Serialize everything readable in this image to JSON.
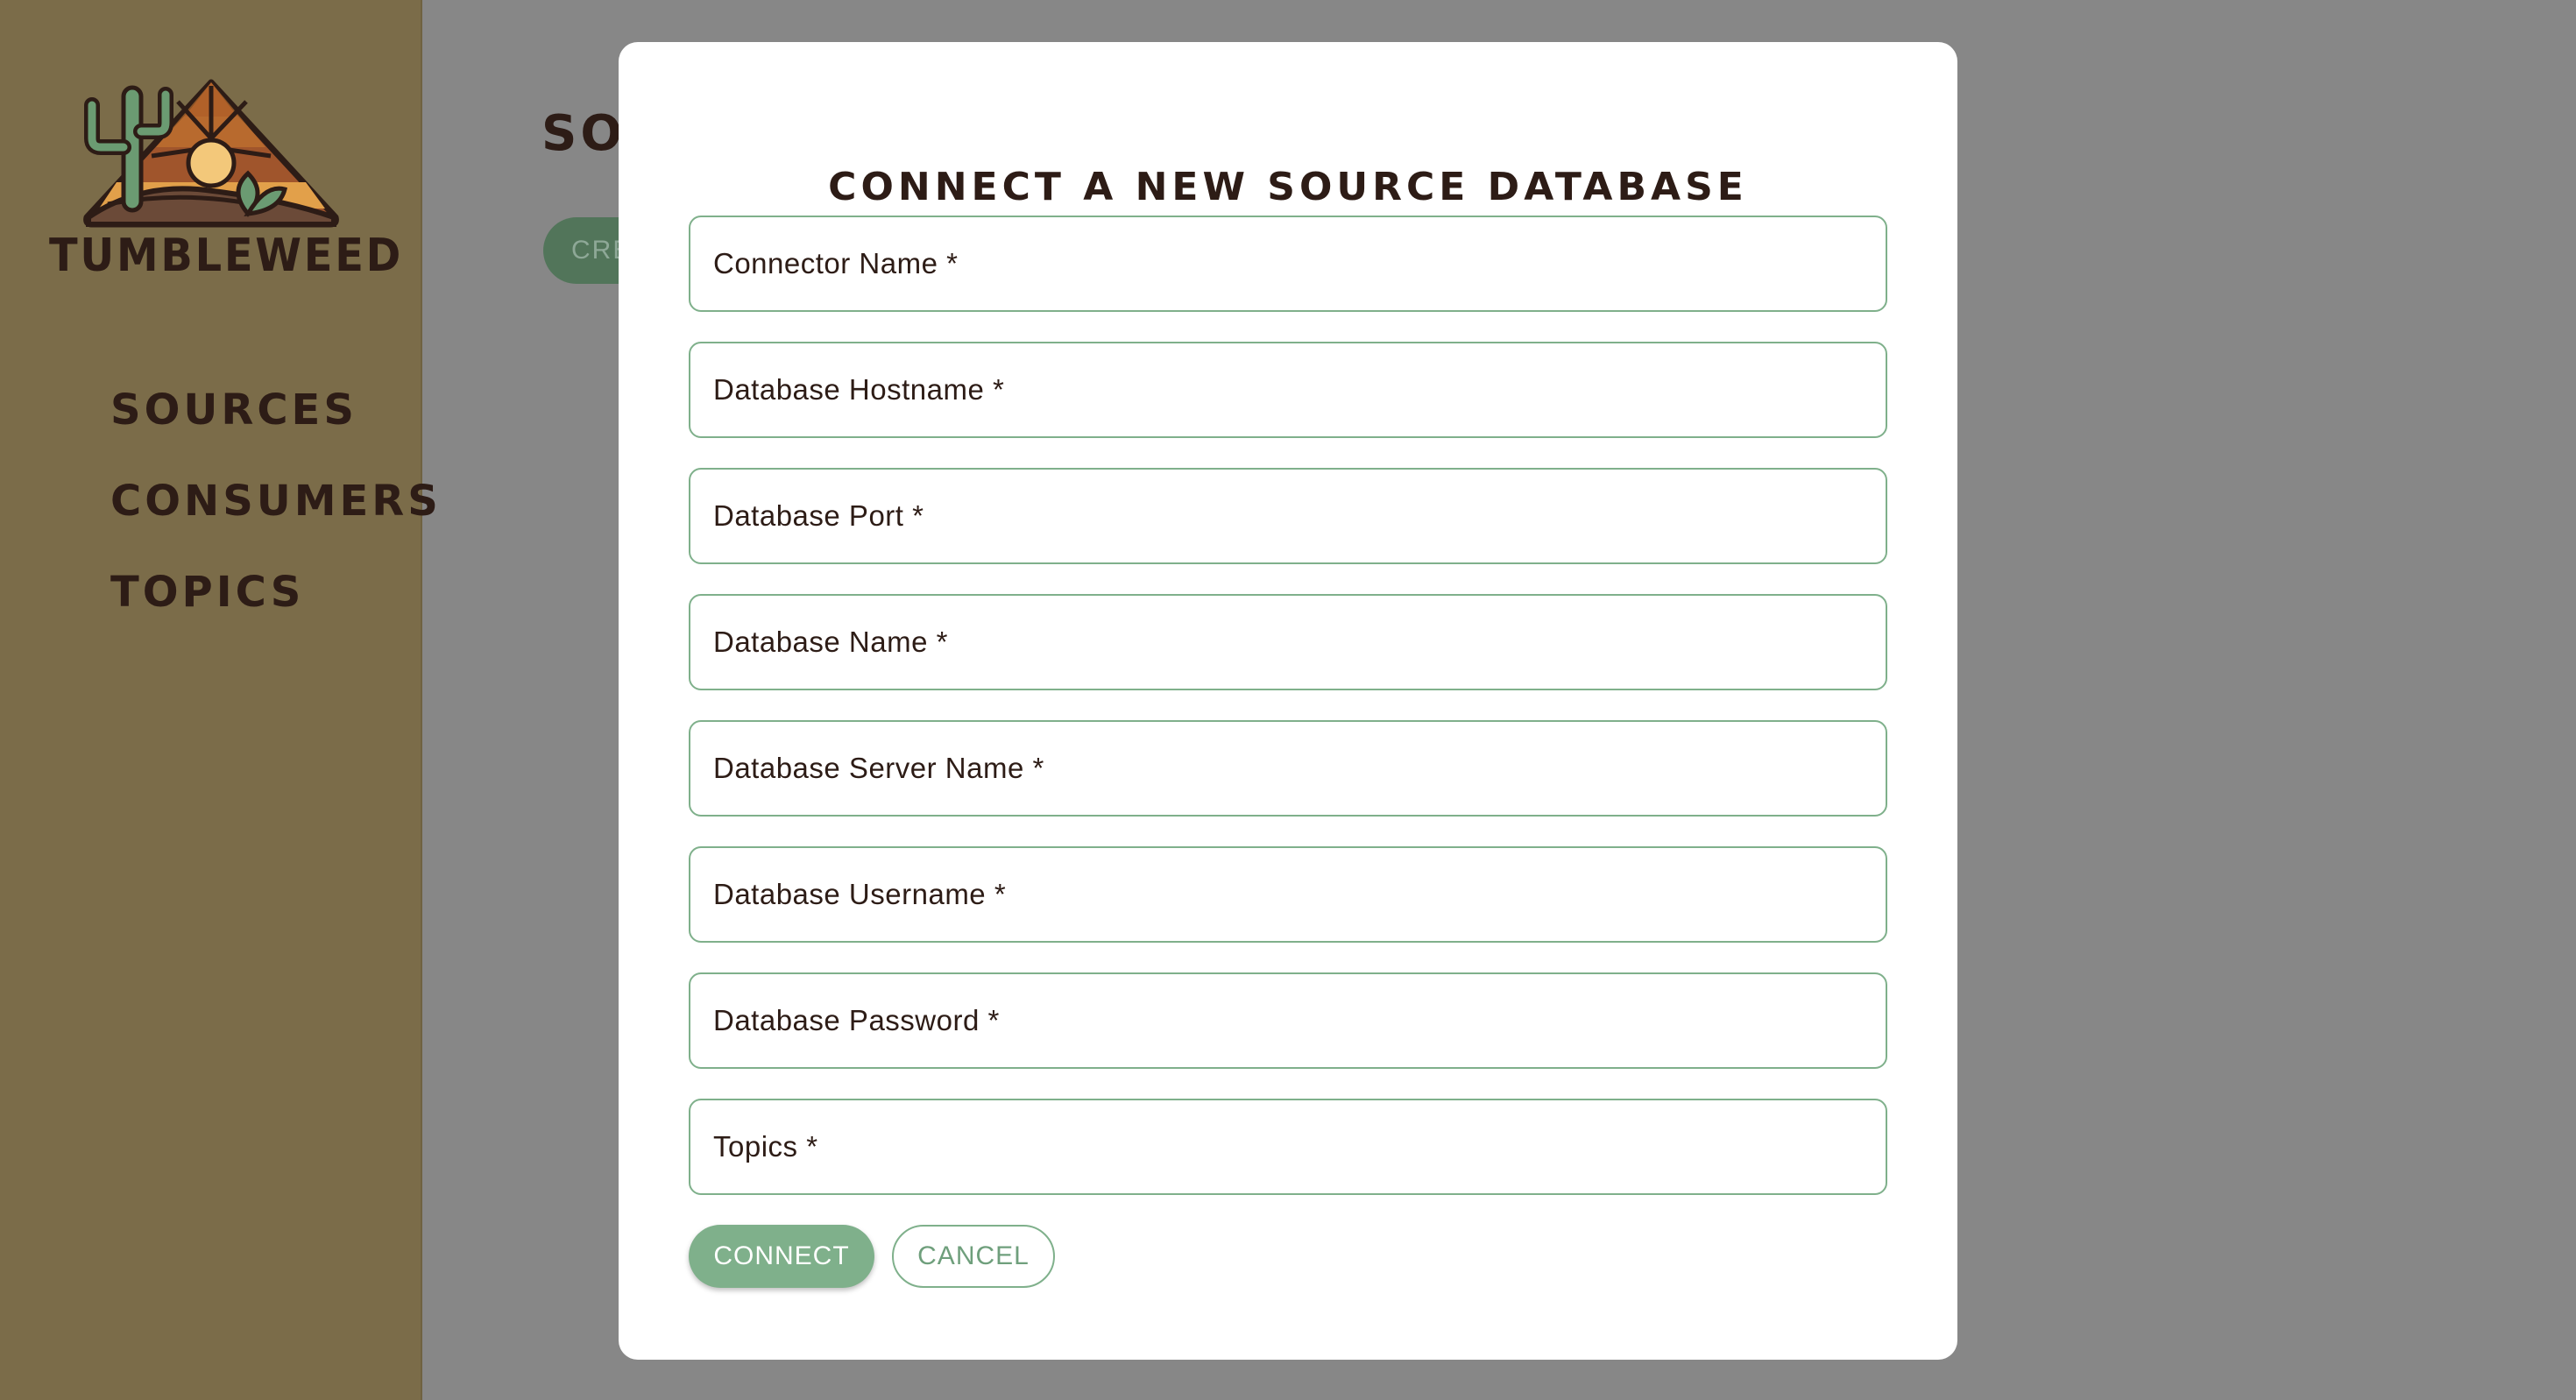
{
  "sidebar": {
    "brand": "TUMBLEWEED",
    "logo_icon": "desert-sunset-cactus-logo",
    "nav_items": [
      {
        "label": "SOURCES"
      },
      {
        "label": "CONSUMERS"
      },
      {
        "label": "TOPICS"
      }
    ]
  },
  "main": {
    "title_partial": "SOU",
    "create_button_partial": "CRE"
  },
  "modal": {
    "title": "CONNECT A NEW SOURCE DATABASE",
    "fields": [
      {
        "label": "Connector Name *",
        "value": ""
      },
      {
        "label": "Database Hostname *",
        "value": ""
      },
      {
        "label": "Database Port *",
        "value": ""
      },
      {
        "label": "Database Name *",
        "value": ""
      },
      {
        "label": "Database Server Name *",
        "value": ""
      },
      {
        "label": "Database Username *",
        "value": ""
      },
      {
        "label": "Database Password *",
        "value": ""
      },
      {
        "label": "Topics *",
        "value": ""
      }
    ],
    "connect_label": "CONNECT",
    "cancel_label": "CANCEL"
  },
  "colors": {
    "sidebar_bg": "#7b6c49",
    "overlay_bg": "#878787",
    "accent_green": "#7fb08b",
    "text_dark": "#2d1c16"
  }
}
